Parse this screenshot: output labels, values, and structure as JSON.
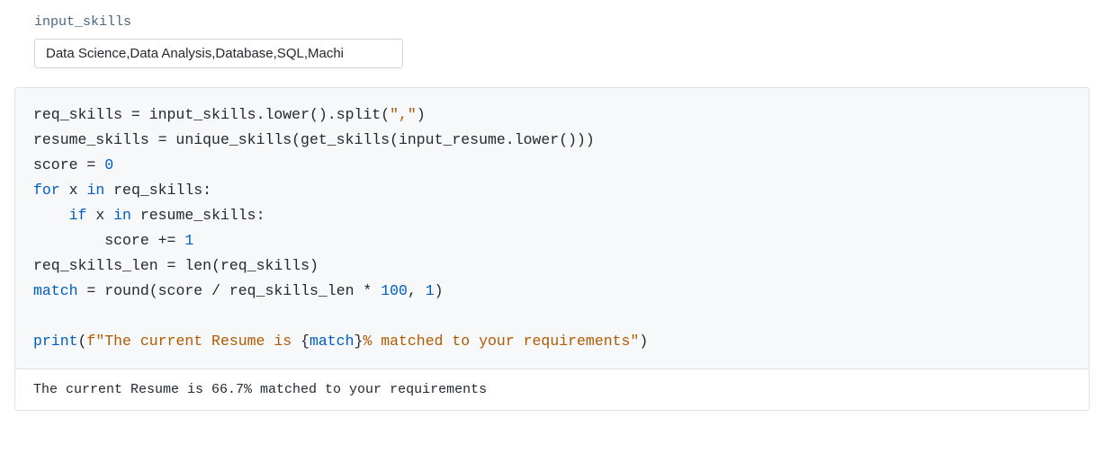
{
  "widget": {
    "label": "input_skills",
    "value": "Data Science,Data Analysis,Database,SQL,Machi"
  },
  "code": {
    "tokens": [
      {
        "t": "req_skills ",
        "c": ""
      },
      {
        "t": "=",
        "c": ""
      },
      {
        "t": " input_skills",
        "c": ""
      },
      {
        "t": ".",
        "c": ""
      },
      {
        "t": "lower",
        "c": ""
      },
      {
        "t": "()",
        "c": ""
      },
      {
        "t": ".",
        "c": ""
      },
      {
        "t": "split",
        "c": ""
      },
      {
        "t": "(",
        "c": ""
      },
      {
        "t": "\",\"",
        "c": "c-str"
      },
      {
        "t": ")",
        "c": ""
      },
      {
        "t": "\n",
        "c": ""
      },
      {
        "t": "resume_skills ",
        "c": ""
      },
      {
        "t": "=",
        "c": ""
      },
      {
        "t": " unique_skills(get_skills(input_resume",
        "c": ""
      },
      {
        "t": ".",
        "c": ""
      },
      {
        "t": "lower",
        "c": ""
      },
      {
        "t": "()))",
        "c": ""
      },
      {
        "t": "\n",
        "c": ""
      },
      {
        "t": "score ",
        "c": ""
      },
      {
        "t": "=",
        "c": ""
      },
      {
        "t": " ",
        "c": ""
      },
      {
        "t": "0",
        "c": "c-num"
      },
      {
        "t": "\n",
        "c": ""
      },
      {
        "t": "for",
        "c": "c-kw"
      },
      {
        "t": " x ",
        "c": ""
      },
      {
        "t": "in",
        "c": "c-kw"
      },
      {
        "t": " req_skills:",
        "c": ""
      },
      {
        "t": "\n",
        "c": ""
      },
      {
        "t": "    ",
        "c": ""
      },
      {
        "t": "if",
        "c": "c-kw"
      },
      {
        "t": " x ",
        "c": ""
      },
      {
        "t": "in",
        "c": "c-kw"
      },
      {
        "t": " resume_skills:",
        "c": ""
      },
      {
        "t": "\n",
        "c": ""
      },
      {
        "t": "        score ",
        "c": ""
      },
      {
        "t": "+=",
        "c": ""
      },
      {
        "t": " ",
        "c": ""
      },
      {
        "t": "1",
        "c": "c-num"
      },
      {
        "t": "\n",
        "c": ""
      },
      {
        "t": "req_skills_len ",
        "c": ""
      },
      {
        "t": "=",
        "c": ""
      },
      {
        "t": " ",
        "c": ""
      },
      {
        "t": "len",
        "c": ""
      },
      {
        "t": "(req_skills)",
        "c": ""
      },
      {
        "t": "\n",
        "c": ""
      },
      {
        "t": "match",
        "c": "c-name"
      },
      {
        "t": " ",
        "c": ""
      },
      {
        "t": "=",
        "c": ""
      },
      {
        "t": " ",
        "c": ""
      },
      {
        "t": "round",
        "c": ""
      },
      {
        "t": "(score ",
        "c": ""
      },
      {
        "t": "/",
        "c": ""
      },
      {
        "t": " req_skills_len ",
        "c": ""
      },
      {
        "t": "*",
        "c": ""
      },
      {
        "t": " ",
        "c": ""
      },
      {
        "t": "100",
        "c": "c-num"
      },
      {
        "t": ", ",
        "c": ""
      },
      {
        "t": "1",
        "c": "c-num"
      },
      {
        "t": ")",
        "c": ""
      },
      {
        "t": "\n",
        "c": ""
      },
      {
        "t": "\n",
        "c": ""
      },
      {
        "t": "print",
        "c": "c-builtin"
      },
      {
        "t": "(",
        "c": ""
      },
      {
        "t": "f\"The current Resume is ",
        "c": "c-str"
      },
      {
        "t": "{",
        "c": ""
      },
      {
        "t": "match",
        "c": "c-name"
      },
      {
        "t": "}",
        "c": ""
      },
      {
        "t": "% matched to your requirements\"",
        "c": "c-str"
      },
      {
        "t": ")",
        "c": ""
      }
    ]
  },
  "output": {
    "text": "The current Resume is 66.7% matched to your requirements"
  }
}
